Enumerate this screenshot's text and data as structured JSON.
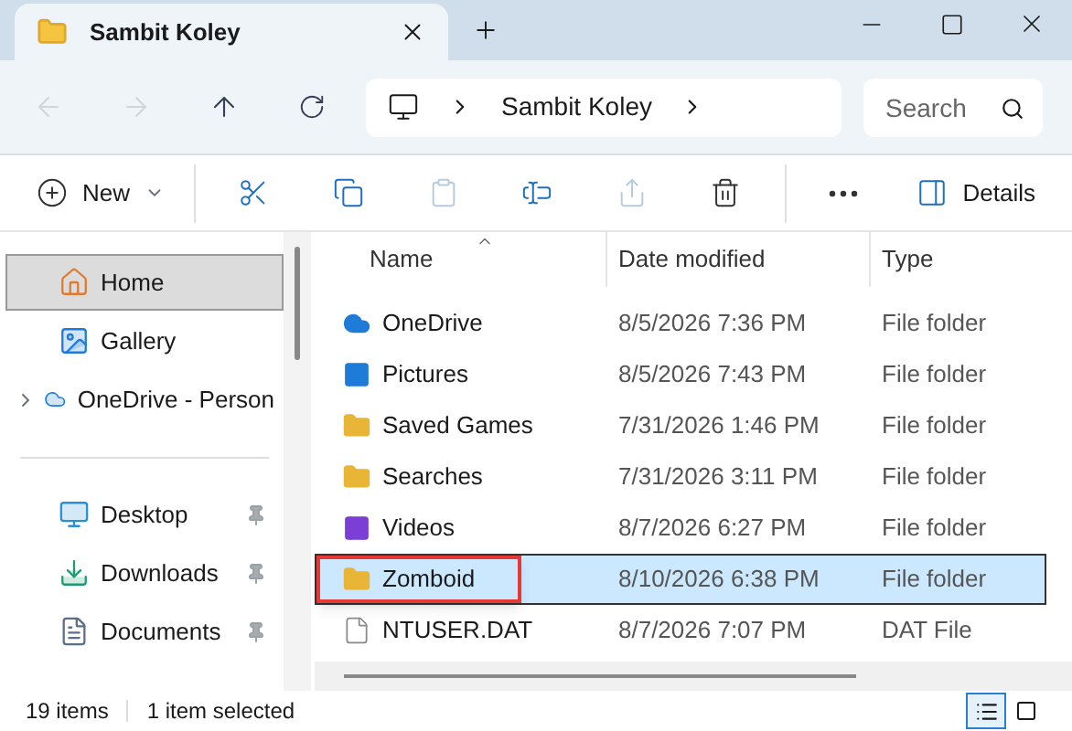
{
  "window": {
    "tab": {
      "title": "Sambit Koley",
      "selected": true
    }
  },
  "nav": {
    "back": {
      "disabled": true
    },
    "forward": {
      "disabled": true
    },
    "up": {
      "disabled": false
    }
  },
  "address": {
    "crumbs": [
      "Sambit Koley"
    ]
  },
  "search": {
    "placeholder": "Search"
  },
  "toolbar": {
    "buttons": [
      {
        "kind": "new",
        "label": "New",
        "disabled": false
      },
      {
        "kind": "cut",
        "disabled": false
      },
      {
        "kind": "copy",
        "disabled": false
      },
      {
        "kind": "paste",
        "disabled": true
      },
      {
        "kind": "rename",
        "disabled": false
      },
      {
        "kind": "share",
        "disabled": true
      },
      {
        "kind": "delete",
        "disabled": false
      },
      {
        "kind": "more",
        "disabled": false
      },
      {
        "kind": "details",
        "label": "Details",
        "disabled": false
      }
    ]
  },
  "sidebar": {
    "items": [
      {
        "kind": "home",
        "label": "Home",
        "selected": true,
        "pinned": false,
        "expandable": false
      },
      {
        "kind": "gallery",
        "label": "Gallery",
        "selected": false,
        "pinned": false,
        "expandable": false
      },
      {
        "kind": "cloud",
        "label": "OneDrive - Person",
        "selected": false,
        "pinned": false,
        "expandable": true
      },
      {
        "kind": "divider"
      },
      {
        "kind": "desktop",
        "label": "Desktop",
        "selected": false,
        "pinned": true,
        "expandable": false
      },
      {
        "kind": "downloads",
        "label": "Downloads",
        "selected": false,
        "pinned": true,
        "expandable": false
      },
      {
        "kind": "documents",
        "label": "Documents",
        "selected": false,
        "pinned": true,
        "expandable": false
      }
    ]
  },
  "table": {
    "columns": [
      "Name",
      "Date modified",
      "Type"
    ],
    "rows": [
      {
        "kind": "cloud",
        "name": "OneDrive",
        "date": "8/5/2026 7:36 PM",
        "type": "File folder",
        "selected": false,
        "highlighted": false
      },
      {
        "kind": "pictures",
        "name": "Pictures",
        "date": "8/5/2026 7:43 PM",
        "type": "File folder",
        "selected": false,
        "highlighted": false
      },
      {
        "kind": "folder",
        "name": "Saved Games",
        "date": "7/31/2026 1:46 PM",
        "type": "File folder",
        "selected": false,
        "highlighted": false
      },
      {
        "kind": "folder",
        "name": "Searches",
        "date": "7/31/2026 3:11 PM",
        "type": "File folder",
        "selected": false,
        "highlighted": false
      },
      {
        "kind": "videos",
        "name": "Videos",
        "date": "8/7/2026 6:27 PM",
        "type": "File folder",
        "selected": false,
        "highlighted": false
      },
      {
        "kind": "folder",
        "name": "Zomboid",
        "date": "8/10/2026 6:38 PM",
        "type": "File folder",
        "selected": true,
        "highlighted": true
      },
      {
        "kind": "file",
        "name": "NTUSER.DAT",
        "date": "8/7/2026 7:07 PM",
        "type": "DAT File",
        "selected": false,
        "highlighted": false
      }
    ]
  },
  "status_bar": {
    "count": "19 items",
    "selection": "1 item selected",
    "views": [
      {
        "kind": "details",
        "selected": true
      },
      {
        "kind": "tiles",
        "selected": false
      }
    ]
  }
}
